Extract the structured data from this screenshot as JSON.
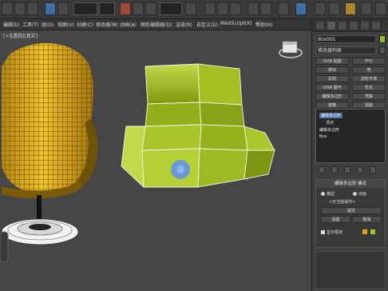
{
  "colors": {
    "accent_selection": "#4c6ea3",
    "object_color": "#8fbf24",
    "chair_yellow": "#e3b21f",
    "gizmo_blue": "#5d8ff2"
  },
  "menu": {
    "items": [
      "编辑(E)",
      "工具(T)",
      "组(G)",
      "视图(V)",
      "创建(C)",
      "修改器(M)",
      "动画(A)",
      "图形编辑器(D)",
      "渲染(R)",
      "自定义(U)",
      "MAXScript(X)",
      "帮助(H)"
    ]
  },
  "viewport": {
    "label": "[+][透视][真实]"
  },
  "command_panel": {
    "object_name": "Box001",
    "modifier_list": "修改器列表",
    "buttons": [
      "UVW 贴图",
      "FFD",
      "挤出",
      "壳",
      "车削",
      "涡轮平滑",
      "UVW 展开",
      "优化",
      "编辑多边形",
      "弯曲",
      "镜像",
      "扭曲"
    ],
    "stack": [
      "编辑多边形",
      "顶点",
      "编辑多边形",
      "Box"
    ],
    "rollout": {
      "title": "编辑多边形 模式",
      "opt_model": "模型",
      "opt_anim": "动画",
      "no_action": "<无当前操作>",
      "commit": "提交",
      "settings": "设置",
      "cancel": "取消",
      "show_cage": "显示框架"
    }
  }
}
